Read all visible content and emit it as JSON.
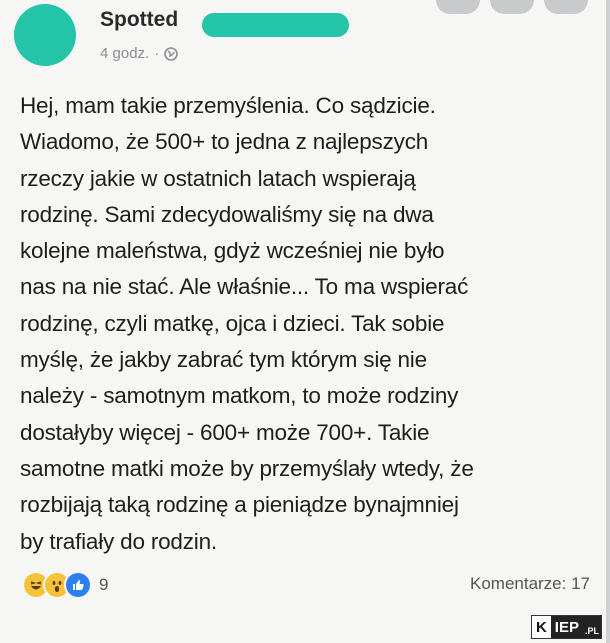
{
  "post": {
    "page_name": "Spotted",
    "time": "4 godz.",
    "dot": "·",
    "icons": {
      "avatar": "avatar",
      "privacy": "globe-icon"
    },
    "lines": [
      "Hej, mam takie przemyślenia. Co sądzicie.",
      "Wiadomo, że 500+ to jedna z najlepszych",
      "rzeczy jakie w ostatnich latach wspierają",
      "rodzinę. Sami zdecydowaliśmy się na dwa",
      "kolejne maleństwa, gdyż wcześniej nie było",
      "nas na nie stać. Ale właśnie... To ma wspierać",
      "rodzinę, czyli matkę, ojca i dzieci. Tak sobie",
      "myślę, że jakby zabrać tym którym się nie",
      "należy - samotnym matkom, to może rodziny",
      "dostałyby więcej - 600+ może 700+. Takie",
      "samotne matki może by przemyślały wtedy, że",
      "rozbijają taką rodzinę a pieniądze bynajmniej",
      "by trafiały do rodzin."
    ]
  },
  "footer": {
    "reaction_icons": [
      "haha-icon",
      "wow-icon",
      "like-icon"
    ],
    "reaction_count": "9",
    "comments": "Komentarze: 17"
  },
  "watermark": {
    "part1": "K",
    "part2": "IEP",
    "part3": ".PL"
  },
  "colors": {
    "redaction": "#23c4a7",
    "card": "#f6f6f4",
    "like": "#2d7ff0",
    "emoji": "#f5c33b"
  }
}
